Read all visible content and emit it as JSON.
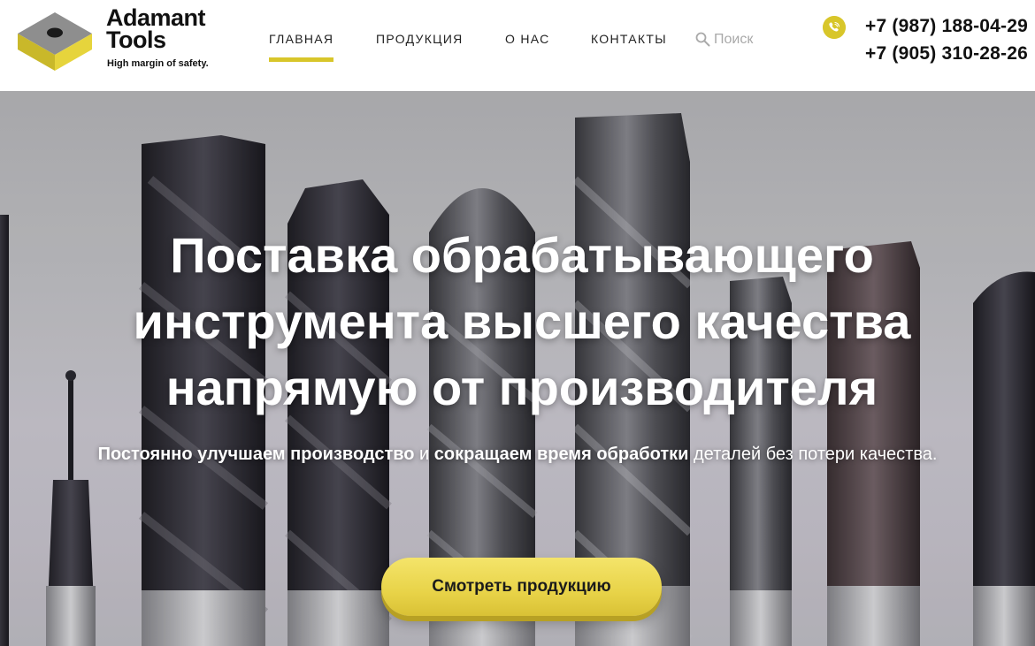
{
  "brand": {
    "name_line1": "Adamant",
    "name_line2": "Tools",
    "tagline": "High margin of safety.",
    "accent": "#d8c62a"
  },
  "nav": {
    "items": [
      {
        "label": "ГЛАВНАЯ",
        "active": true
      },
      {
        "label": "ПРОДУКЦИЯ",
        "active": false
      },
      {
        "label": "О НАС",
        "active": false
      },
      {
        "label": "КОНТАКТЫ",
        "active": false
      }
    ]
  },
  "search": {
    "placeholder": "Поиск",
    "icon": "search-icon"
  },
  "contacts": {
    "icon": "viber-icon",
    "phones": [
      "+7 (987) 188-04-29",
      "+7 (905) 310-28-26"
    ]
  },
  "hero": {
    "title_lines": [
      "Поставка обрабатывающего",
      "инструмента высшего качества",
      "напрямую от производителя"
    ],
    "subtitle": {
      "part1": "Постоянно улучшаем производство",
      "part2": " и ",
      "part3": "сокращаем время обработки",
      "part4": " деталей без потери качества."
    },
    "cta_label": "Смотреть продукцию",
    "background": "end-mill-tools-photo"
  }
}
